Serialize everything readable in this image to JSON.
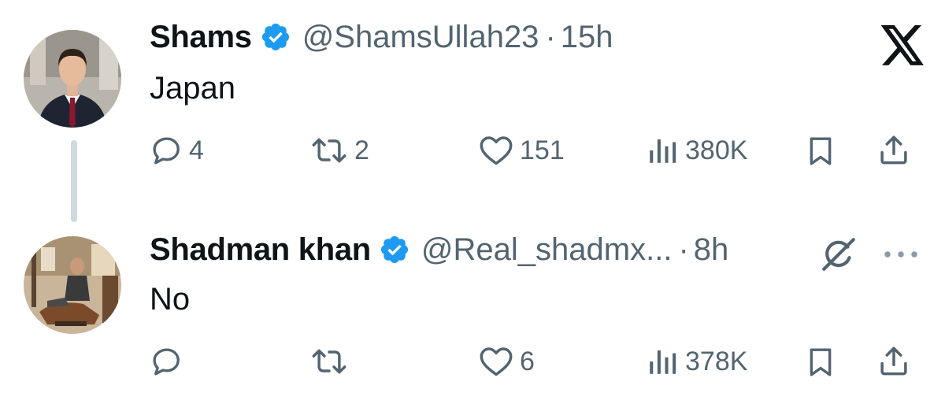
{
  "colors": {
    "text": "#0f1419",
    "secondary": "#536471",
    "verified": "#1d9bf0",
    "thread_line": "#cfd9de"
  },
  "tweets": [
    {
      "display_name": "Shams",
      "handle": "@ShamsUllah23",
      "separator": "·",
      "time": "15h",
      "text": "Japan",
      "verified": true,
      "avatar": "profile-photo-man-in-suit",
      "replies": "4",
      "reposts": "2",
      "likes": "151",
      "views": "380K",
      "top_right_icon": "x-logo-icon"
    },
    {
      "display_name": "Shadman khan",
      "handle": "@Real_shadmx...",
      "separator": "·",
      "time": "8h",
      "text": "No",
      "verified": true,
      "avatar": "profile-photo-man-in-lounge",
      "replies": "",
      "reposts": "",
      "likes": "6",
      "views": "378K",
      "top_right_icons": [
        "grok-icon",
        "more-icon"
      ]
    }
  ]
}
